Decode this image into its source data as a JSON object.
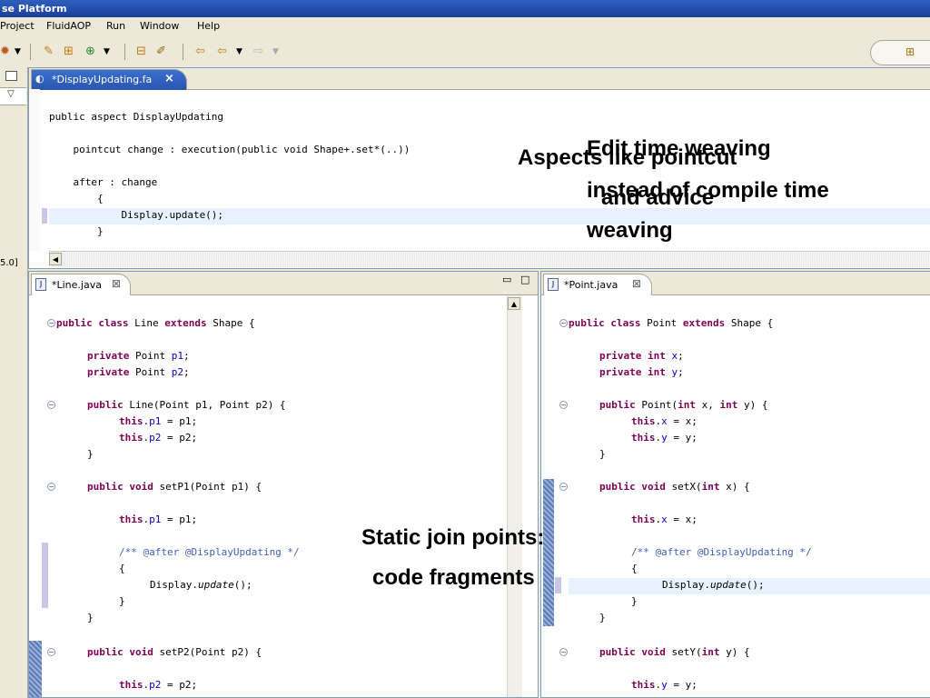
{
  "window": {
    "title": "se Platform"
  },
  "menu": [
    "Project",
    "FluidAOP",
    "Run",
    "Window",
    "Help"
  ],
  "left_panel": {
    "status_text": "5.0]"
  },
  "top_editor": {
    "tab_label": "*DisplayUpdating.fa",
    "close_glyph": "×",
    "lines": [
      "public aspect DisplayUpdating",
      "    pointcut change : execution(public void Shape+.set*(..))",
      "    after : change",
      "        {",
      "            Display.update();",
      "        }"
    ]
  },
  "line_editor": {
    "tab_label": "*Line.java",
    "close_glyph": "⊠",
    "lines": {
      "class_decl": [
        "public",
        " ",
        "class",
        " Line ",
        "extends",
        " Shape {"
      ],
      "f1": [
        "private",
        " Point ",
        "p1",
        ";"
      ],
      "f2": [
        "private",
        " Point ",
        "p2",
        ";"
      ],
      "ctor": [
        "public",
        " Line(Point p1, Point p2) {"
      ],
      "ctor_b1": [
        "this",
        ".",
        "p1",
        " = p1;"
      ],
      "ctor_b2": [
        "this",
        ".",
        "p2",
        " = p2;"
      ],
      "close1": "}",
      "m1": [
        "public",
        " ",
        "void",
        " setP1(Point p1) {"
      ],
      "m1_b1": [
        "this",
        ".",
        "p1",
        " = p1;"
      ],
      "m1_cmt": "/** @after @DisplayUpdating */",
      "m1_open": "{",
      "m1_call": [
        "Display.",
        "update",
        "();"
      ],
      "m1_close_inner": "}",
      "m1_close": "}",
      "m2": [
        "public",
        " ",
        "void",
        " setP2(Point p2) {"
      ],
      "m2_b1": [
        "this",
        ".",
        "p2",
        " = p2;"
      ]
    }
  },
  "point_editor": {
    "tab_label": "*Point.java",
    "close_glyph": "⊠",
    "lines": {
      "class_decl": [
        "public",
        " ",
        "class",
        " Point ",
        "extends",
        " Shape {"
      ],
      "f1": [
        "private",
        " ",
        "int",
        " ",
        "x",
        ";"
      ],
      "f2": [
        "private",
        " ",
        "int",
        " ",
        "y",
        ";"
      ],
      "ctor": [
        "public",
        " Point(",
        "int",
        " x, ",
        "int",
        " y) {"
      ],
      "ctor_b1": [
        "this",
        ".",
        "x",
        " = x;"
      ],
      "ctor_b2": [
        "this",
        ".",
        "y",
        " = y;"
      ],
      "close1": "}",
      "m1": [
        "public",
        " ",
        "void",
        " setX(",
        "int",
        " x) {"
      ],
      "m1_b1": [
        "this",
        ".",
        "x",
        " = x;"
      ],
      "m1_cmt": "/** @after @DisplayUpdating */",
      "m1_open": "{",
      "m1_call": [
        "Display.",
        "update",
        "();"
      ],
      "m1_close_inner": "}",
      "m1_close": "}",
      "m2": [
        "public",
        " ",
        "void",
        " setY(",
        "int",
        " y) {"
      ],
      "m2_b1": [
        "this",
        ".",
        "y",
        " = y;"
      ]
    }
  },
  "overlays": {
    "aspects_line1": "Aspects like pointcut",
    "aspects_line2": "and advice",
    "edit_time_line1": "Edit time weaving",
    "edit_time_line2": "instead of compile time",
    "edit_time_line3": "weaving",
    "static_line1": "Static join points:",
    "static_line2": "code fragments"
  }
}
